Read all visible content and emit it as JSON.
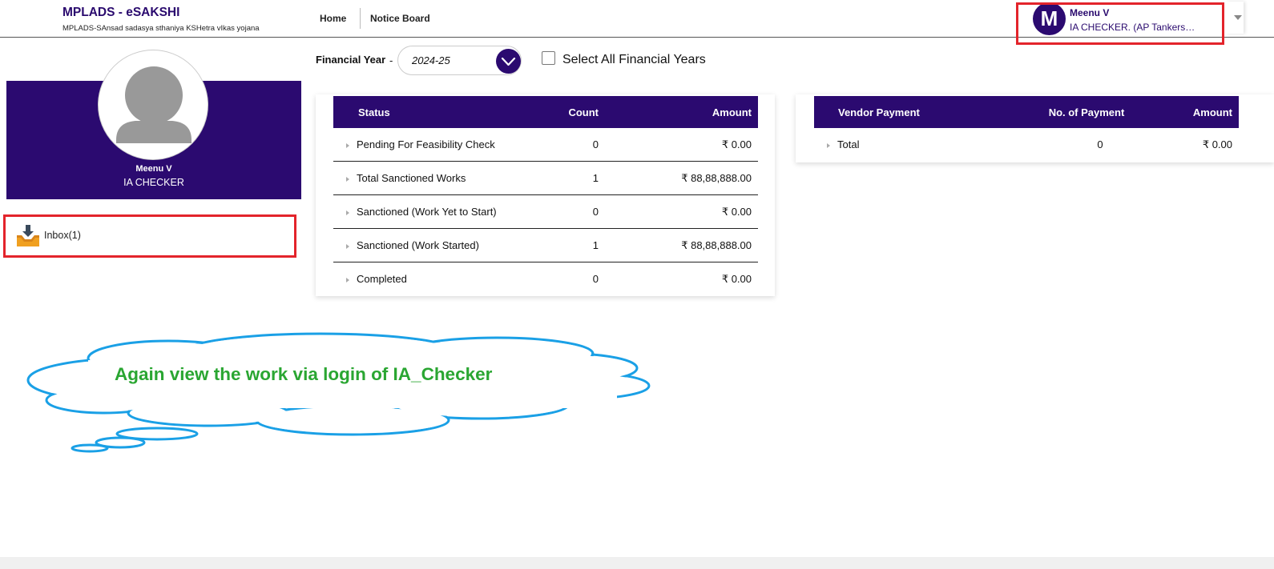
{
  "header": {
    "brand_title": "MPLADS - eSAKSHI",
    "brand_subtitle": "MPLADS-SAnsad sadasya sthaniya KSHetra vIkas yojana",
    "nav": [
      {
        "label": "Home"
      },
      {
        "label": "Notice Board"
      }
    ],
    "user": {
      "initial": "M",
      "name": "Meenu V",
      "role": "IA CHECKER. (AP Tankers…"
    }
  },
  "profile": {
    "name": "Meenu V",
    "role": "IA CHECKER",
    "inbox_label": "Inbox(1)"
  },
  "filter": {
    "fy_label": "Financial Year",
    "fy_dash": "-",
    "fy_value": "2024-25",
    "select_all_label": "Select All Financial Years",
    "select_all_checked": false
  },
  "status_table": {
    "headers": [
      "Status",
      "Count",
      "Amount"
    ],
    "rows": [
      {
        "status": "Pending For Feasibility Check",
        "count": "0",
        "amount": "₹ 0.00"
      },
      {
        "status": "Total Sanctioned Works",
        "count": "1",
        "amount": "₹ 88,88,888.00"
      },
      {
        "status": "Sanctioned (Work Yet to Start)",
        "count": "0",
        "amount": "₹ 0.00"
      },
      {
        "status": "Sanctioned (Work Started)",
        "count": "1",
        "amount": "₹ 88,88,888.00"
      },
      {
        "status": "Completed",
        "count": "0",
        "amount": "₹ 0.00"
      }
    ]
  },
  "vendor_table": {
    "headers": [
      "Vendor Payment",
      "No. of Payment",
      "Amount"
    ],
    "rows": [
      {
        "vendor": "Total",
        "count": "0",
        "amount": "₹ 0.00"
      }
    ]
  },
  "callout": {
    "text": "Again view the work via login of IA_Checker"
  },
  "colors": {
    "brand": "#2b0a70",
    "highlight": "#e3242b",
    "callout_text": "#2aa632",
    "callout_outline": "#1aa0e6"
  }
}
